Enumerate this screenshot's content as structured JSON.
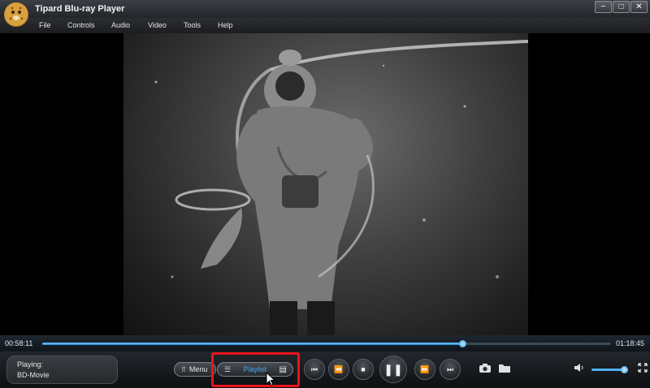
{
  "window": {
    "title": "Tipard Blu-ray Player",
    "controls": {
      "minimize": "−",
      "maximize": "□",
      "close": "✕"
    }
  },
  "menu": [
    "File",
    "Controls",
    "Audio",
    "Video",
    "Tools",
    "Help"
  ],
  "seek": {
    "elapsed": "00:58:11",
    "total": "01:18:45",
    "progress": 0.739
  },
  "status": {
    "label": "Playing:",
    "title": "BD-Movie"
  },
  "controls": {
    "menu_label": "Menu",
    "playlist_label": "Playlist",
    "icons": [
      "prev-chapter-icon",
      "rewind-icon",
      "stop-icon",
      "pause-icon",
      "fast-forward-icon",
      "next-chapter-icon",
      "camera-icon",
      "folder-icon",
      "volume-icon",
      "fullscreen-icon"
    ]
  },
  "volume": {
    "level": 0.9
  },
  "colors": {
    "accent": "#4aa8f0",
    "highlight": "#e8141c"
  }
}
